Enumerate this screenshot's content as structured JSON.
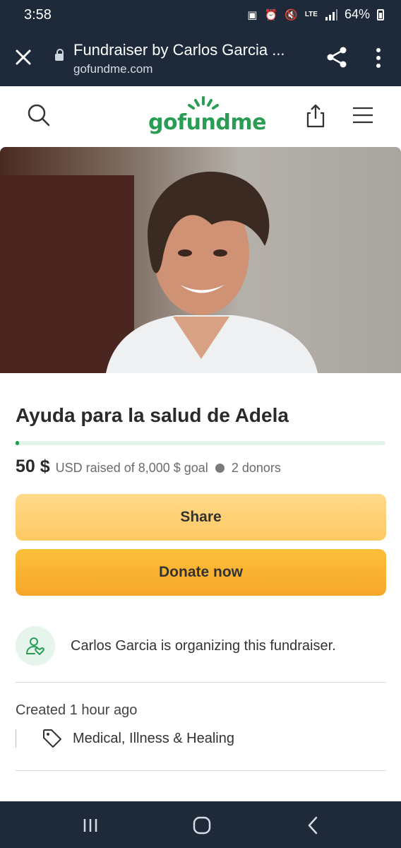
{
  "status_bar": {
    "time": "3:58",
    "network": "LTE",
    "battery": "64%",
    "icons": [
      "wallet-icon",
      "alarm-icon",
      "mute-icon",
      "lte-icon",
      "signal-icon",
      "battery-icon"
    ]
  },
  "browser": {
    "title": "Fundraiser by Carlos Garcia ...",
    "url": "gofundme.com",
    "icons": [
      "close-icon",
      "lock-icon",
      "share-icon",
      "more-vert-icon"
    ]
  },
  "site": {
    "logo_text": "gofundme",
    "icons": [
      "search-icon",
      "share-upload-icon",
      "hamburger-menu-icon"
    ]
  },
  "campaign": {
    "title": "Ayuda para la salud de Adela",
    "raised_amount": "50 $",
    "raised_detail": "USD raised of 8,000 $ goal",
    "donors": "2 donors",
    "progress_fraction": 0.00625,
    "share_label": "Share",
    "donate_label": "Donate now",
    "organizer_text": "Carlos Garcia is organizing this fundraiser.",
    "created": "Created 1 hour ago",
    "category": "Medical, Illness & Healing"
  },
  "colors": {
    "brand_green": "#2a9d55",
    "system_bar": "#1e2a3a",
    "share_button": "#ffd07a",
    "donate_button": "#f9b132",
    "progress_track": "#e3f3ea"
  },
  "nav_bar": {
    "icons": [
      "recent-apps-icon",
      "home-icon",
      "back-icon"
    ]
  }
}
